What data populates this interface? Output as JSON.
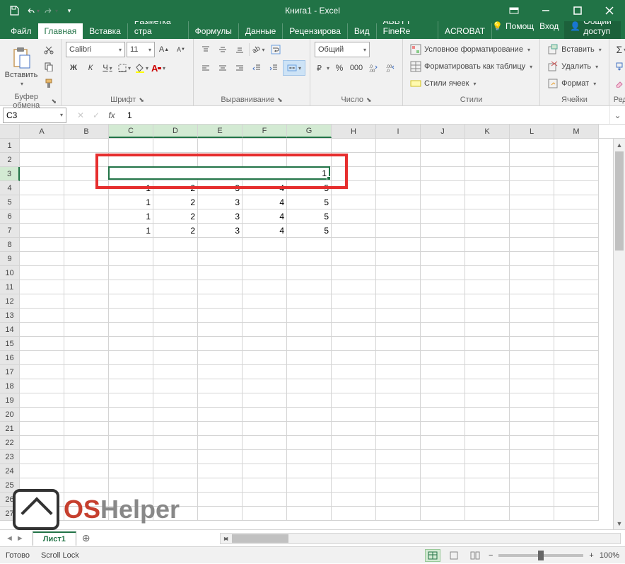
{
  "title": "Книга1 - Excel",
  "tabs": {
    "file": "Файл",
    "home": "Главная",
    "insert": "Вставка",
    "layout": "Разметка стра",
    "formulas": "Формулы",
    "data": "Данные",
    "review": "Рецензирова",
    "view": "Вид",
    "abbyy": "ABBYY FineRe",
    "acrobat": "ACROBAT"
  },
  "tell_me": "Помощ",
  "login": "Вход",
  "share": "Общий доступ",
  "ribbon": {
    "clipboard": {
      "paste": "Вставить",
      "label": "Буфер обмена"
    },
    "font": {
      "name": "Calibri",
      "size": "11",
      "bold": "Ж",
      "italic": "К",
      "underline": "Ч",
      "label": "Шрифт"
    },
    "alignment": {
      "label": "Выравнивание"
    },
    "number": {
      "format": "Общий",
      "label": "Число"
    },
    "styles": {
      "conditional": "Условное форматирование",
      "table": "Форматировать как таблицу",
      "cell": "Стили ячеек",
      "label": "Стили"
    },
    "cells": {
      "insert": "Вставить",
      "delete": "Удалить",
      "format": "Формат",
      "label": "Ячейки"
    },
    "editing": {
      "label": "Редактирование"
    }
  },
  "namebox": "C3",
  "formula": "1",
  "columns": [
    "A",
    "B",
    "C",
    "D",
    "E",
    "F",
    "G",
    "H",
    "I",
    "J",
    "K",
    "L",
    "M"
  ],
  "selected_cols": [
    "C",
    "D",
    "E",
    "F",
    "G"
  ],
  "row_count": 27,
  "selected_row": 3,
  "merged_cell": {
    "row": 3,
    "c1": 2,
    "c2": 6,
    "value": "1"
  },
  "cells": [
    {
      "r": 4,
      "c": 2,
      "v": "1"
    },
    {
      "r": 4,
      "c": 3,
      "v": "2"
    },
    {
      "r": 4,
      "c": 4,
      "v": "3"
    },
    {
      "r": 4,
      "c": 5,
      "v": "4"
    },
    {
      "r": 4,
      "c": 6,
      "v": "5"
    },
    {
      "r": 5,
      "c": 2,
      "v": "1"
    },
    {
      "r": 5,
      "c": 3,
      "v": "2"
    },
    {
      "r": 5,
      "c": 4,
      "v": "3"
    },
    {
      "r": 5,
      "c": 5,
      "v": "4"
    },
    {
      "r": 5,
      "c": 6,
      "v": "5"
    },
    {
      "r": 6,
      "c": 2,
      "v": "1"
    },
    {
      "r": 6,
      "c": 3,
      "v": "2"
    },
    {
      "r": 6,
      "c": 4,
      "v": "3"
    },
    {
      "r": 6,
      "c": 5,
      "v": "4"
    },
    {
      "r": 6,
      "c": 6,
      "v": "5"
    },
    {
      "r": 7,
      "c": 2,
      "v": "1"
    },
    {
      "r": 7,
      "c": 3,
      "v": "2"
    },
    {
      "r": 7,
      "c": 4,
      "v": "3"
    },
    {
      "r": 7,
      "c": 5,
      "v": "4"
    },
    {
      "r": 7,
      "c": 6,
      "v": "5"
    }
  ],
  "sheet": "Лист1",
  "status": {
    "ready": "Готово",
    "scroll": "Scroll Lock",
    "zoom": "100%"
  },
  "watermark": {
    "os": "OS",
    "helper": "Helper"
  }
}
